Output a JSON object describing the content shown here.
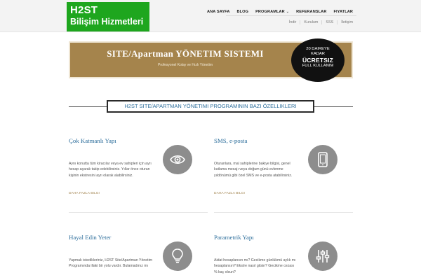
{
  "header": {
    "logo_line1": "H2ST",
    "logo_line2": "Bilişim Hizmetleri",
    "main_nav": [
      "ANA SAYFA",
      "BLOG",
      "PROGRAMLAR",
      "REFERANSLAR",
      "FIYATLAR"
    ],
    "sub_nav": [
      "İndir",
      "Kurulum",
      "SSS",
      "İletişim"
    ]
  },
  "banner": {
    "title": "SITE/Apartman YÖNETIM SISTEMI",
    "subtitle": "Profesyonel Kolay ve Hızlı Yönetim",
    "badge_line1": "20 DAIREYE",
    "badge_line2": "KADAR",
    "badge_line3": "ÜCRETSIZ",
    "badge_line4": "FULL KULLANIM"
  },
  "section": {
    "heading": "H2ST SITE/APARTMAN YÖNETIMI PROGRAMININ BAZI ÖZELLIKLERI"
  },
  "features": [
    {
      "title": "Çok Katmanlı Yapı",
      "text": "Aynı konutta tüm kiracılar veya ev sahipleri için ayrı hesap açarak takip edebilirsiniz. Yıllar önce oturan kişinin ekstresini ayrı olarak alabilirsiniz.",
      "link": "DAHA FAZLA BILGI",
      "icon": "eye-icon"
    },
    {
      "title": "SMS, e-posta",
      "text": "Oturanlara, mal sahiplerine bakiye bilgisi, genel kutlama mesajı veya doğum günü evlenme yıldönümü gibi özel SMS ve e-posta atabilirsiniz.",
      "link": "DAHA FAZLA BILGI",
      "icon": "tablet-icon"
    },
    {
      "title": "Hayal Edin Yeter",
      "text": "Yapmak istedikleriniz, H2ST Site/Apartman Yönetim Programında illaki bir yolu vardır. Bulamadınız mı",
      "icon": "lightbulb-icon"
    },
    {
      "title": "Parametrik Yapı",
      "text": "Aidat hesaplansın mı? Gecikme günlükmü aylık mı hesaplansın? Ekstre nasıl gitsin? Gecikme cezası % kaç olsun?",
      "icon": "sliders-icon"
    }
  ]
}
